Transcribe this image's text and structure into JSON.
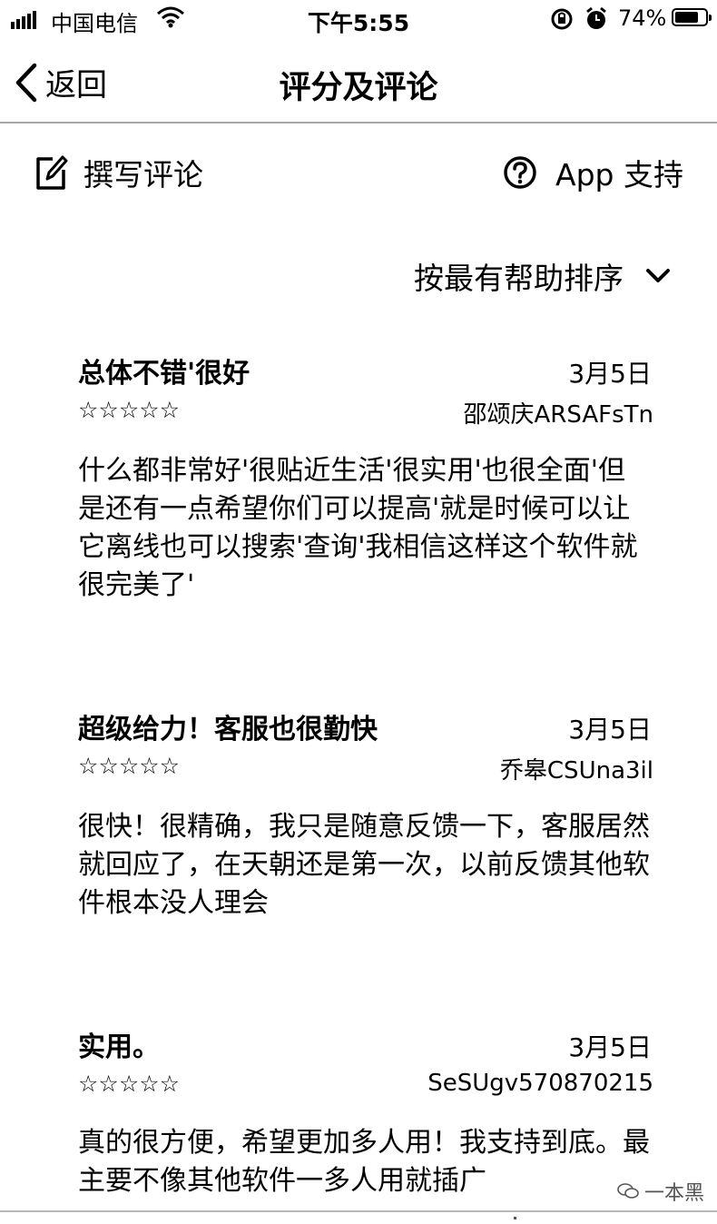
{
  "status_bar": {
    "carrier": "中国电信",
    "time": "下午5:55",
    "battery": "74%",
    "battery_level": 0.74,
    "icons": [
      "signal-icon",
      "wifi-icon",
      "orientation-lock-icon",
      "alarm-icon",
      "battery-icon"
    ]
  },
  "nav": {
    "back_label": "返回",
    "title": "评分及评论"
  },
  "actions": {
    "write_review": "撰写评论",
    "app_support": "App 支持"
  },
  "sort": {
    "label": "按最有帮助排序"
  },
  "reviews": [
    {
      "title": "总体不错'很好",
      "date": "3月5日",
      "stars": "☆☆☆☆☆",
      "author": "邵颂庆ARSAFsTn",
      "body": "什么都非常好'很贴近生活'很实用'也很全面'但是还有一点希望你们可以提高'就是时候可以让它离线也可以搜索'查询'我相信这样这个软件就很完美了'"
    },
    {
      "title": "超级给力！客服也很勤快",
      "date": "3月5日",
      "stars": "☆☆☆☆☆",
      "author": "乔皋CSUna3il",
      "body": "很快！很精确，我只是随意反馈一下，客服居然就回应了，在天朝还是第一次，以前反馈其他软件根本没人理会"
    },
    {
      "title": "实用。",
      "date": "3月5日",
      "stars": "☆☆☆☆☆",
      "author": "SeSUgv570870215",
      "body": "真的很方便，希望更加多人用！我支持到底。最主要不像其他软件一多人用就插广"
    }
  ],
  "watermark": "一本黑"
}
